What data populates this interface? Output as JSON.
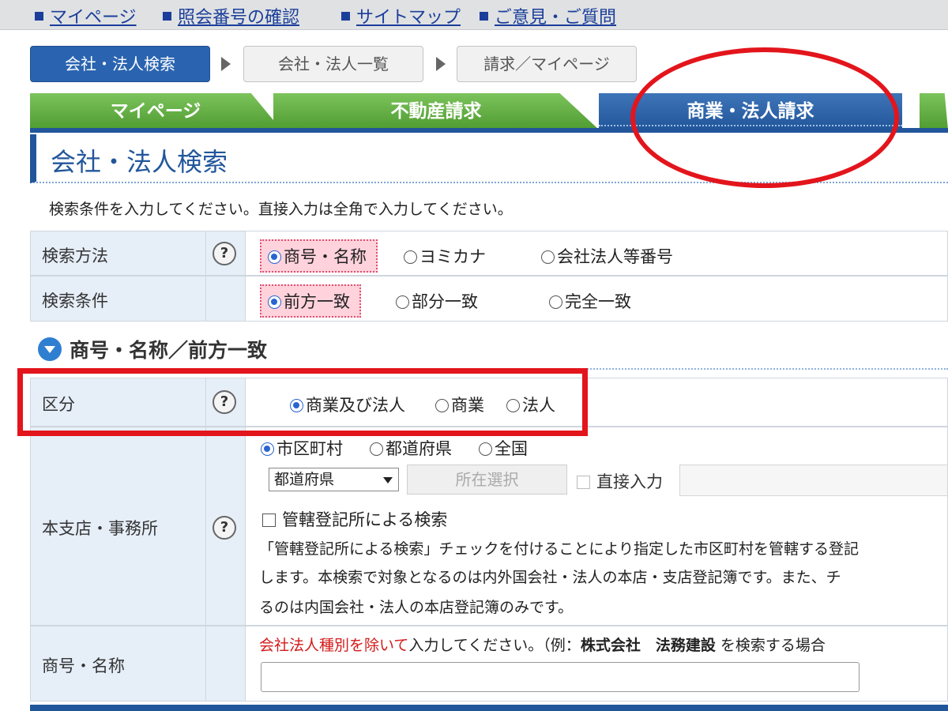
{
  "top_links": [
    "マイページ",
    "照会番号の確認",
    "サイトマップ",
    "ご意見・ご質問"
  ],
  "steps": [
    "会社・法人検索",
    "会社・法人一覧",
    "請求／マイページ"
  ],
  "tabs": [
    "マイページ",
    "不動産請求",
    "商業・法人請求"
  ],
  "page_title": "会社・法人検索",
  "instruction": "検索条件を入力してください。直接入力は全角で入力してください。",
  "help_icon": "?",
  "colors": {
    "accent_blue": "#22569b",
    "tab_green": "#5aa83a",
    "annotation_red": "#e3151c",
    "highlight_pink": "#ffd2dc"
  },
  "search_method": {
    "label": "検索方法",
    "options": [
      "商号・名称",
      "ヨミカナ",
      "会社法人等番号"
    ],
    "selected": "商号・名称"
  },
  "search_condition": {
    "label": "検索条件",
    "options": [
      "前方一致",
      "部分一致",
      "完全一致"
    ],
    "selected": "前方一致"
  },
  "section_title": "商号・名称／前方一致",
  "kubun": {
    "label": "区分",
    "options": [
      "商業及び法人",
      "商業",
      "法人"
    ],
    "selected": "商業及び法人"
  },
  "branch": {
    "label": "本支店・事務所",
    "scope_options": [
      "市区町村",
      "都道府県",
      "全国"
    ],
    "scope_selected": "市区町村",
    "prefecture_select": "都道府県",
    "location_button": "所在選択",
    "direct_input_label": "直接入力",
    "jurisdiction_label": "管轄登記所による検索",
    "description_lines": [
      "「管轄登記所による検索」チェックを付けることにより指定した市区町村を管轄する登記",
      "します。本検索で対象となるのは内外国会社・法人の本店・支店登記簿です。また、チ",
      "るのは内国会社・法人の本店登記簿のみです。"
    ]
  },
  "company_name": {
    "label": "商号・名称",
    "hint_red": "会社法人種別を除いて",
    "hint_text": "入力してください。（例：",
    "hint_example": "株式会社　法務建設",
    "hint_tail": " を検索する場合"
  }
}
